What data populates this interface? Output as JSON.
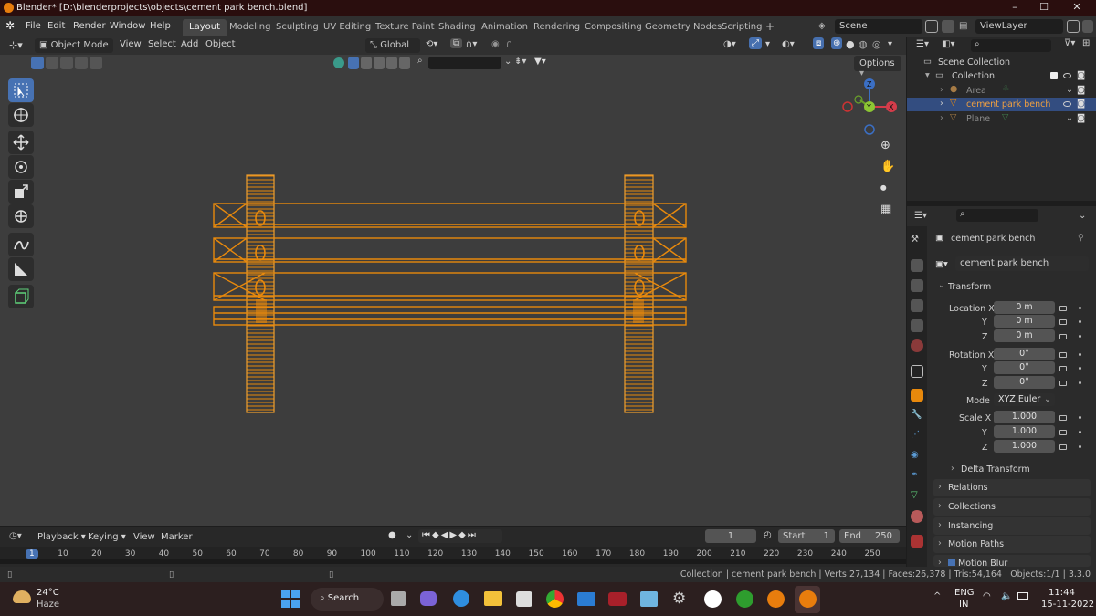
{
  "window": {
    "title": "Blender* [D:\\blenderprojects\\objects\\cement park bench.blend]",
    "controls": [
      "–",
      "☐",
      "✕"
    ]
  },
  "menu": {
    "items": [
      "File",
      "Edit",
      "Render",
      "Window",
      "Help"
    ],
    "workspaces": [
      "Layout",
      "Modeling",
      "Sculpting",
      "UV Editing",
      "Texture Paint",
      "Shading",
      "Animation",
      "Rendering",
      "Compositing",
      "Geometry Nodes",
      "Scripting"
    ],
    "active_workspace": "Layout",
    "add_tab": "+",
    "scene": "Scene",
    "view_layer": "ViewLayer"
  },
  "viewport_header": {
    "mode": "Object Mode",
    "menus": [
      "View",
      "Select",
      "Add",
      "Object"
    ],
    "orientation": "Global",
    "options_label": "Options"
  },
  "gizmo": {
    "x": "X",
    "y": "Y",
    "z": "Z"
  },
  "outliner": {
    "root": "Scene Collection",
    "collection": "Collection",
    "objects": [
      {
        "name": "Area",
        "selected": false
      },
      {
        "name": "cement park bench",
        "selected": true
      },
      {
        "name": "Plane",
        "selected": false
      }
    ]
  },
  "properties": {
    "object_name": "cement park bench",
    "object_field": "cement park bench",
    "transform_label": "Transform",
    "location": {
      "label": "Location X",
      "x": "0 m",
      "y": "0 m",
      "z": "0 m"
    },
    "rotation": {
      "label": "Rotation X",
      "x": "0°",
      "y": "0°",
      "z": "0°"
    },
    "mode_label": "Mode",
    "mode_value": "XYZ Euler",
    "scale": {
      "label": "Scale X",
      "x": "1.000",
      "y": "1.000",
      "z": "1.000"
    },
    "axis_y": "Y",
    "axis_z": "Z",
    "sections": [
      "Delta Transform",
      "Relations",
      "Collections",
      "Instancing",
      "Motion Paths",
      "Motion Blur"
    ]
  },
  "timeline": {
    "menus": [
      "Playback",
      "Keying",
      "View",
      "Marker"
    ],
    "current_frame": "1",
    "start_label": "Start",
    "start": "1",
    "end_label": "End",
    "end": "250",
    "ruler": [
      "1",
      "10",
      "20",
      "30",
      "40",
      "50",
      "60",
      "70",
      "80",
      "90",
      "100",
      "110",
      "120",
      "130",
      "140",
      "150",
      "160",
      "170",
      "180",
      "190",
      "200",
      "210",
      "220",
      "230",
      "240",
      "250"
    ]
  },
  "statusbar": {
    "text": "Collection | cement park bench | Verts:27,134 | Faces:26,378 | Tris:54,164 | Objects:1/1 | 3.3.0"
  },
  "taskbar": {
    "weather_temp": "24°C",
    "weather_desc": "Haze",
    "search_label": "Search",
    "lang": "ENG",
    "region": "IN",
    "time": "11:44",
    "date": "15-11-2022"
  },
  "colors": {
    "accent": "#4772b3",
    "selection_orange": "#e8890c",
    "viewport_bg": "#3d3d3d"
  }
}
